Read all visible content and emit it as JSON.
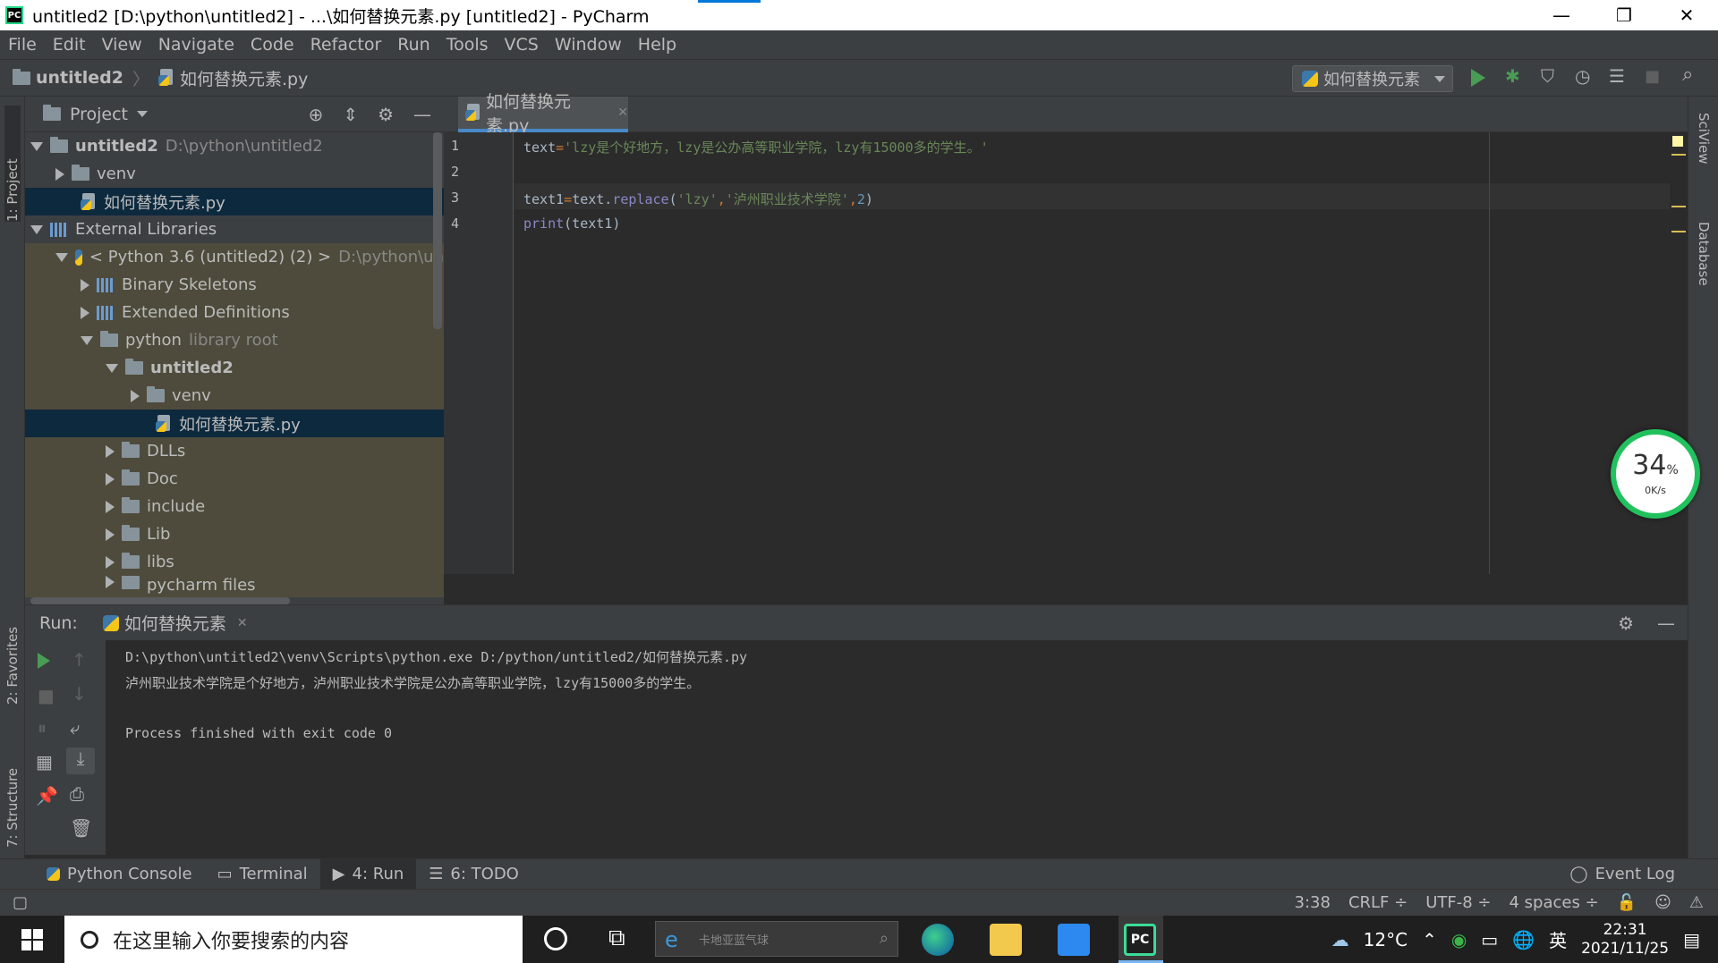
{
  "window": {
    "title": "untitled2 [D:\\python\\untitled2] - ...\\如何替换元素.py [untitled2] - PyCharm",
    "logo": "PC",
    "controls": {
      "minimize": "—",
      "restore": "❐",
      "close": "✕"
    }
  },
  "menu": [
    "File",
    "Edit",
    "View",
    "Navigate",
    "Code",
    "Refactor",
    "Run",
    "Tools",
    "VCS",
    "Window",
    "Help"
  ],
  "navbar": {
    "project": "untitled2",
    "file": "如何替换元素.py",
    "run_config": "如何替换元素"
  },
  "left_stripe": {
    "project": "1: Project",
    "favorites": "2: Favorites",
    "structure": "7: Structure"
  },
  "right_stripe": {
    "sciview": "SciView",
    "database": "Database"
  },
  "project_panel": {
    "title": "Project",
    "tree": [
      {
        "name": "untitled2",
        "extra": "D:\\python\\untitled2"
      },
      {
        "name": "venv"
      },
      {
        "name": "如何替换元素.py"
      },
      {
        "name": "External Libraries"
      },
      {
        "name": "< Python 3.6 (untitled2) (2) >",
        "extra": "D:\\python\\un"
      },
      {
        "name": "Binary Skeletons"
      },
      {
        "name": "Extended Definitions"
      },
      {
        "name": "python",
        "extra": "library root"
      },
      {
        "name": "untitled2"
      },
      {
        "name": "venv"
      },
      {
        "name": "如何替换元素.py"
      },
      {
        "name": "DLLs"
      },
      {
        "name": "Doc"
      },
      {
        "name": "include"
      },
      {
        "name": "Lib"
      },
      {
        "name": "libs"
      },
      {
        "name": "pycharm files"
      }
    ]
  },
  "editor": {
    "tab": "如何替换元素.py",
    "line_numbers": [
      "1",
      "2",
      "3",
      "4"
    ],
    "line1": {
      "var": "text",
      "eq": "=",
      "str": "'lzy是个好地方，lzy是公办高等职业学院，lzy有15000多的学生。'"
    },
    "line3": {
      "var": "text1",
      "eq": "=",
      "obj": "text.",
      "fn": "replace",
      "open": "(",
      "s1": "'lzy'",
      "c1": ",",
      "s2": "'泸州职业技术学院'",
      "c2": ",",
      "num": "2",
      "close": ")"
    },
    "line4": {
      "fn": "print",
      "args": "(text1)"
    }
  },
  "run_panel": {
    "label": "Run:",
    "tab": "如何替换元素",
    "output": [
      "D:\\python\\untitled2\\venv\\Scripts\\python.exe D:/python/untitled2/如何替换元素.py",
      "泸州职业技术学院是个好地方，泸州职业技术学院是公办高等职业学院，lzy有15000多的学生。",
      "",
      "Process finished with exit code 0"
    ]
  },
  "cpu_widget": {
    "percent": "34",
    "unit": "%",
    "speed": "0K/s"
  },
  "bottom_tabs": [
    {
      "label": "Python Console"
    },
    {
      "label": "Terminal"
    },
    {
      "label": "4: Run"
    },
    {
      "label": "6: TODO"
    }
  ],
  "event_log": "Event Log",
  "status": {
    "position": "3:38",
    "line_sep": "CRLF ÷",
    "encoding": "UTF-8 ÷",
    "indent": "4 spaces ÷"
  },
  "taskbar": {
    "search_placeholder": "在这里输入你要搜索的内容",
    "weather_search": "卡地亚蓝气球",
    "temperature": "12°C",
    "ime": "英",
    "time": "22:31",
    "date": "2021/11/25"
  },
  "colors": {
    "accent": "#4A88C7",
    "run_green": "#499C54",
    "string": "#6A8759",
    "builtin": "#8888C6",
    "number": "#6897BB",
    "keyword_op": "#CC7832"
  }
}
